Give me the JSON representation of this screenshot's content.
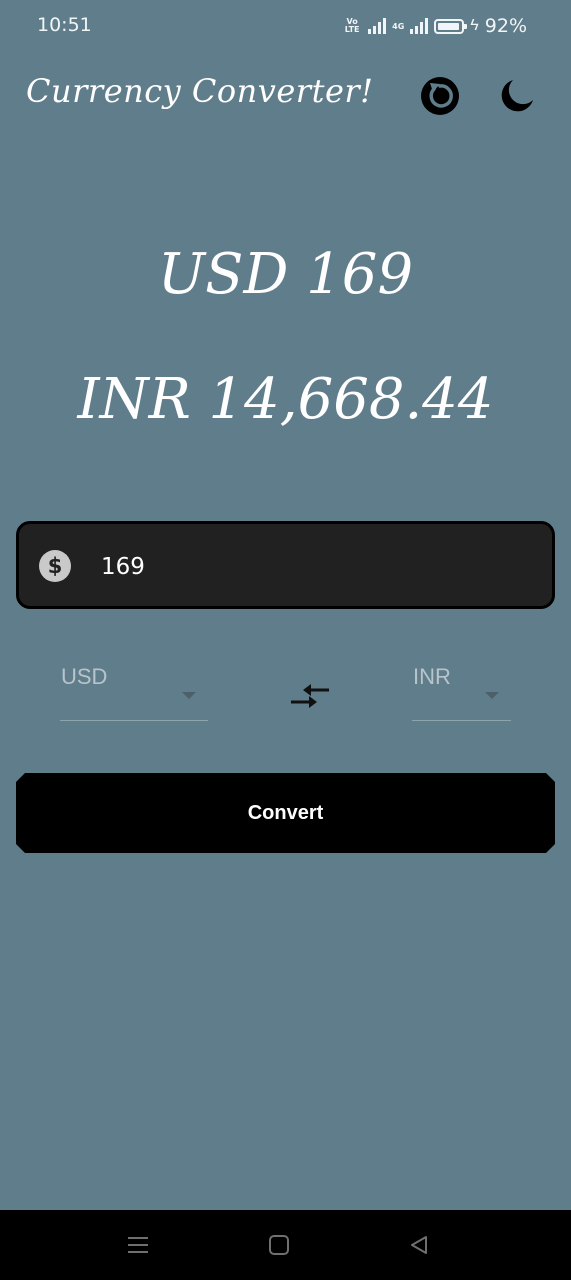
{
  "status_bar": {
    "time": "10:51",
    "volte_label": "Vo LTE",
    "network_label": "4G",
    "battery_percent": 92,
    "battery_text": "92%"
  },
  "header": {
    "title": "Currency Converter!",
    "reset_icon": "reset-icon",
    "theme_icon": "moon-icon"
  },
  "result": {
    "from_line": "USD 169",
    "to_line": "INR 14,668.44"
  },
  "amount_input": {
    "value": "169",
    "icon": "dollar-icon"
  },
  "currency_select": {
    "from": "USD",
    "to": "INR",
    "swap_icon": "swap-arrows-icon"
  },
  "convert_button": {
    "label": "Convert"
  },
  "navigation": {
    "recents_icon": "menu-icon",
    "home_icon": "home-icon",
    "back_icon": "back-icon"
  },
  "colors": {
    "background": "#607d8b",
    "input_background": "#212121",
    "button_background": "#000000",
    "text": "#ffffff"
  }
}
